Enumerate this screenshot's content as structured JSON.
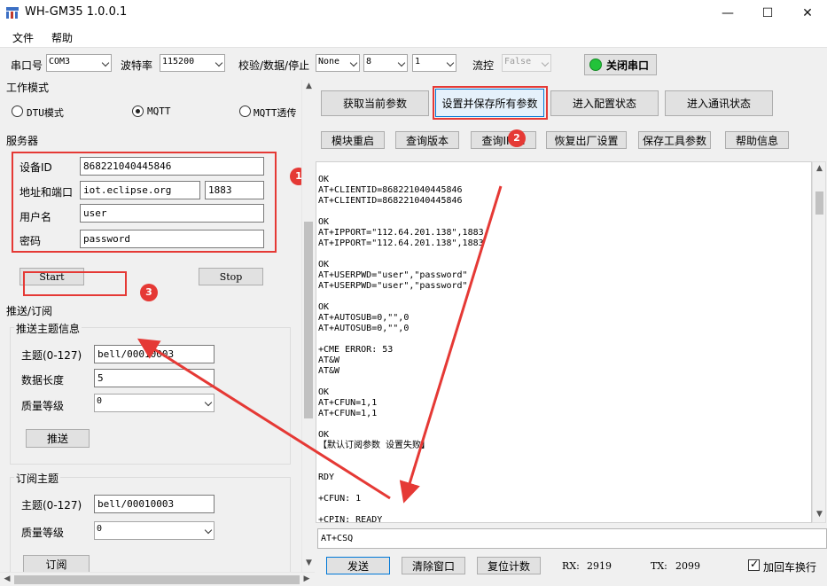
{
  "window": {
    "title": "WH-GM35 1.0.0.1",
    "minimize": "—",
    "maximize": "☐",
    "close": "✕"
  },
  "menu": {
    "file": "文件",
    "help": "帮助"
  },
  "serial": {
    "port_label": "串口号",
    "port_value": "COM3",
    "baud_label": "波特率",
    "baud_value": "115200",
    "parity_label": "校验/数据/停止",
    "parity_value": "None",
    "data_bits_value": "8",
    "stop_bits_value": "1",
    "flow_label": "流控",
    "flow_value": "False",
    "close_port_button": "关闭串口",
    "status_color": "#22c33a"
  },
  "work_mode": {
    "title": "工作模式",
    "options": [
      {
        "label": "DTU模式",
        "checked": false
      },
      {
        "label": "MQTT",
        "checked": true
      },
      {
        "label": "MQTT透传",
        "checked": false
      }
    ]
  },
  "server": {
    "title": "服务器",
    "device_id_label": "设备ID",
    "device_id_value": "868221040445846",
    "address_label": "地址和端口",
    "address_value": "iot.eclipse.org",
    "port_value": "1883",
    "username_label": "用户名",
    "username_value": "user",
    "password_label": "密码",
    "password_value": "password",
    "start_button": "Start",
    "stop_button": "Stop"
  },
  "pubsub": {
    "title": "推送/订阅",
    "publish": {
      "title": "推送主题信息",
      "topic_label": "主题(0-127)",
      "topic_value": "bell/00010003",
      "length_label": "数据长度",
      "length_value": "5",
      "qos_label": "质量等级",
      "qos_value": "0",
      "send_button": "推送"
    },
    "subscribe": {
      "title": "订阅主题",
      "topic_label": "主题(0-127)",
      "topic_value": "bell/00010003",
      "qos_label": "质量等级",
      "qos_value": "0",
      "subscribe_button": "订阅"
    }
  },
  "actions": {
    "row1": [
      "获取当前参数",
      "设置并保存所有参数",
      "进入配置状态",
      "进入通讯状态"
    ],
    "row2": [
      "模块重启",
      "查询版本",
      "查询IMEI",
      "恢复出厂设置",
      "保存工具参数",
      "帮助信息"
    ]
  },
  "log": {
    "lines": [
      "OK",
      "AT+CLIENTID=868221040445846",
      "AT+CLIENTID=868221040445846",
      "",
      "OK",
      "AT+IPPORT=\"112.64.201.138\",1883",
      "AT+IPPORT=\"112.64.201.138\",1883",
      "",
      "OK",
      "AT+USERPWD=\"user\",\"password\"",
      "AT+USERPWD=\"user\",\"password\"",
      "",
      "OK",
      "AT+AUTOSUB=0,\"\",0",
      "AT+AUTOSUB=0,\"\",0",
      "",
      "+CME ERROR: 53",
      "AT&W",
      "AT&W",
      "",
      "OK",
      "AT+CFUN=1,1",
      "AT+CFUN=1,1",
      "",
      "OK",
      "【默认订阅参数 设置失败】",
      "",
      "",
      "RDY",
      "",
      "+CFUN: 1",
      "",
      "+CPIN: READY"
    ]
  },
  "command": {
    "value": "AT+CSQ"
  },
  "bottom": {
    "send_button": "发送",
    "clear_button": "清除窗口",
    "reset_count_button": "复位计数",
    "rx_label": "RX:",
    "rx_value": "2919",
    "tx_label": "TX:",
    "tx_value": "2099",
    "crlf_label": "加回车换行",
    "crlf_checked": true
  },
  "annotations": {
    "badge1": "1",
    "badge2": "2",
    "badge3": "3",
    "color": "#e53935"
  }
}
